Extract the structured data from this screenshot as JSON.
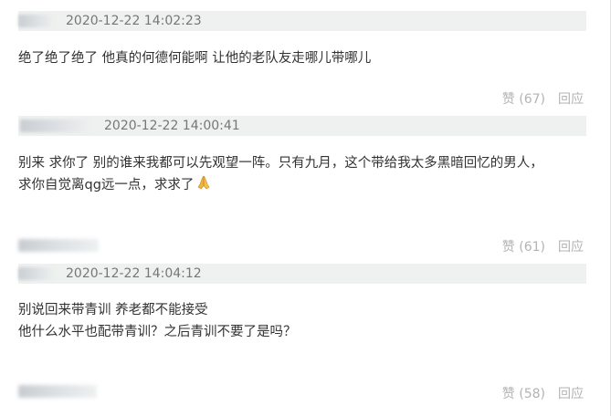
{
  "comments": [
    {
      "timestamp": "2020-12-22 14:02:23",
      "lines": [
        "绝了绝了绝了 他真的何德何能啊 让他的老队友走哪儿带哪儿"
      ],
      "like_label": "赞 (67)",
      "reply_label": "回应"
    },
    {
      "timestamp": "2020-12-22 14:00:41",
      "lines": [
        "别来 求你了 别的谁来我都可以先观望一阵。只有九月，这个带给我太多黑暗回忆的男人，",
        "求你自觉离qg远一点，求求了"
      ],
      "like_label": "赞 (61)",
      "reply_label": "回应"
    },
    {
      "timestamp": "2020-12-22 14:04:12",
      "lines": [
        "别说回来带青训 养老都不能接受",
        "他什么水平也配带青训？之后青训不要了是吗？"
      ],
      "like_label": "赞 (58)",
      "reply_label": "回应"
    }
  ],
  "icons": {
    "pray": "folded-hands-icon"
  },
  "colors": {
    "header_bg": "#eef1ef",
    "meta_text": "#777777",
    "action_text": "#b3b3b3"
  }
}
